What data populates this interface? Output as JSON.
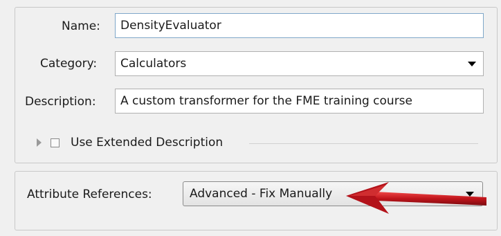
{
  "transformer": {
    "name_label": "Name:",
    "name_value": "DensityEvaluator",
    "category_label": "Category:",
    "category_value": "Calculators",
    "description_label": "Description:",
    "description_value": "A custom transformer for the FME training course",
    "extended_description_label": "Use Extended Description",
    "extended_description_checked": false
  },
  "attributes": {
    "references_label": "Attribute References:",
    "references_value": "Advanced - Fix Manually"
  },
  "annotation": {
    "arrow_color": "#c0141b"
  },
  "icons": [
    "expand-triangle-icon",
    "dropdown-caret-icon"
  ]
}
